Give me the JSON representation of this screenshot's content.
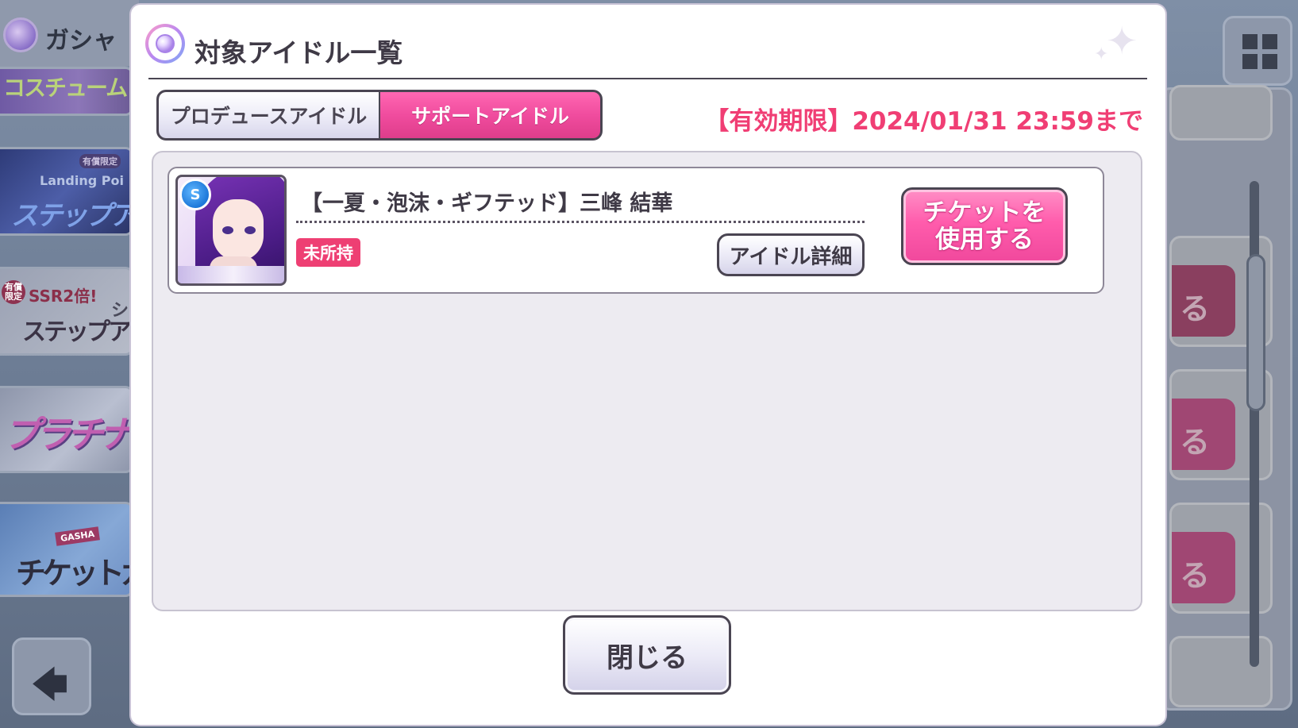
{
  "background": {
    "header_label": "ガシャ",
    "banners": [
      {
        "text": "コスチューム"
      },
      {
        "badge": "有償限定",
        "subtitle": "Landing Poi",
        "title": "ステップアップ"
      },
      {
        "badge": "有償限定",
        "subtitle": "SSR2倍!",
        "extra": "シャ PRオ",
        "title": "ステップアップ"
      },
      {
        "title": "プラチナガ"
      },
      {
        "badge": "GASHA",
        "title": "チケットガ"
      }
    ],
    "right_panel_fragment": "る",
    "back_icon": "left-arrow-icon",
    "menu_icon": "grid-menu-icon"
  },
  "modal": {
    "title": "対象アイドル一覧",
    "title_icon": "idol-emblem-icon",
    "tabs": [
      {
        "label": "プロデュースアイドル",
        "selected": false
      },
      {
        "label": "サポートアイドル",
        "selected": true
      }
    ],
    "expiry": "【有効期限】2024/01/31 23:59まで",
    "idols": [
      {
        "name": "【一夏・泡沫・ギフテッド】三峰 結華",
        "rarity_badge": "S",
        "status": "未所持",
        "detail_button": "アイドル詳細",
        "use_button_line1": "チケットを",
        "use_button_line2": "使用する"
      }
    ],
    "close_button": "閉じる"
  },
  "colors": {
    "accent_pink": "#f04c9e",
    "expiry_red": "#f03e74",
    "status_red": "#ee3f73"
  }
}
